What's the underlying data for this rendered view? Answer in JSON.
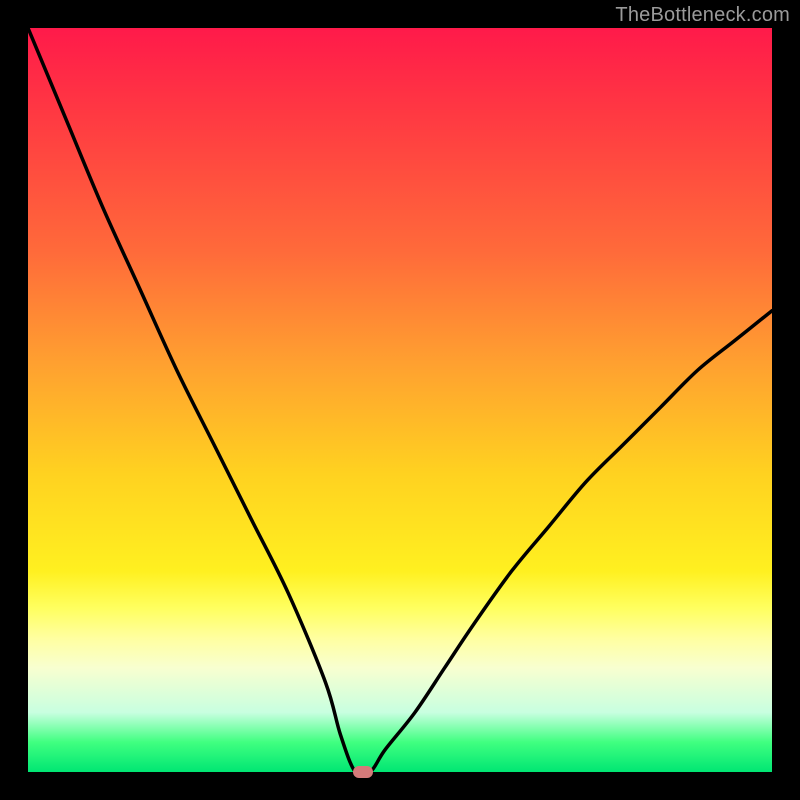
{
  "watermark": "TheBottleneck.com",
  "chart_data": {
    "type": "line",
    "title": "",
    "xlabel": "",
    "ylabel": "",
    "xlim": [
      0,
      100
    ],
    "ylim": [
      0,
      100
    ],
    "grid": false,
    "legend": false,
    "annotations": [],
    "background_gradient": {
      "top": "#ff1a4a",
      "upper_mid": "#ffa030",
      "mid": "#fff020",
      "lower_mid": "#ffffa0",
      "bottom": "#00e673"
    },
    "curve_notes": "V-shaped bottleneck curve. y≈100 at x≈0, drops to y≈0 near x≈44, rises to y≈62 at x≈100. Left side steeper than right.",
    "series": [
      {
        "name": "bottleneck-curve",
        "color": "#000000",
        "x": [
          0,
          5,
          10,
          15,
          20,
          25,
          30,
          35,
          40,
          42,
          44,
          46,
          48,
          52,
          56,
          60,
          65,
          70,
          75,
          80,
          85,
          90,
          95,
          100
        ],
        "y": [
          100,
          88,
          76,
          65,
          54,
          44,
          34,
          24,
          12,
          5,
          0,
          0,
          3,
          8,
          14,
          20,
          27,
          33,
          39,
          44,
          49,
          54,
          58,
          62
        ]
      }
    ],
    "marker": {
      "x": 45,
      "y": 0,
      "color": "#d57a7a"
    }
  }
}
